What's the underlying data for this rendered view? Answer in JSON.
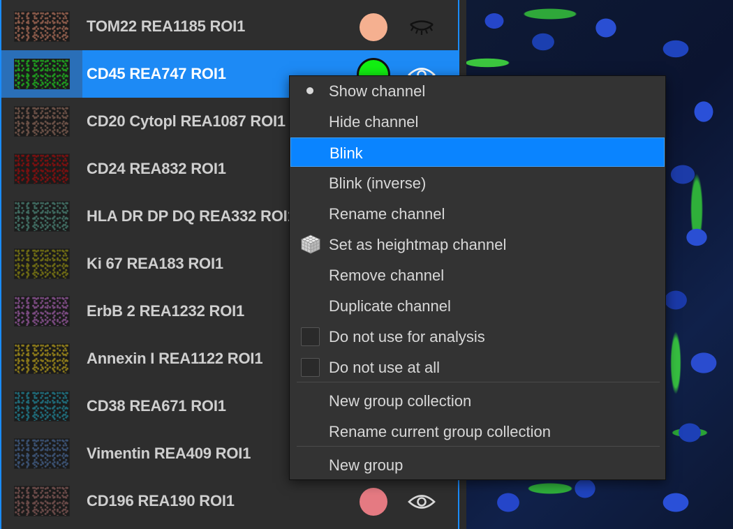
{
  "channels": [
    {
      "label": "TOM22 REA1185 ROI1",
      "swatch": "#f5b090",
      "visibility": "eye-closed-icon",
      "thumb_tint": "#8a5a4a"
    },
    {
      "label": "CD45 REA747 ROI1",
      "swatch": "#12f012",
      "visibility": "eye-open-icon",
      "thumb_tint": "#1f9a1f",
      "selected": true
    },
    {
      "label": "CD20 Cytopl REA1087 ROI1",
      "thumb_tint": "#6a5046"
    },
    {
      "label": "CD24 REA832 ROI1",
      "thumb_tint": "#7a1010"
    },
    {
      "label": "HLA DR DP DQ REA332 ROI1",
      "thumb_tint": "#3f6a60"
    },
    {
      "label": "Ki 67 REA183 ROI1",
      "thumb_tint": "#6d6a14"
    },
    {
      "label": "ErbB 2 REA1232 ROI1",
      "thumb_tint": "#7a4a80"
    },
    {
      "label": "Annexin I REA1122 ROI1",
      "thumb_tint": "#8c7a1a"
    },
    {
      "label": "CD38 REA671 ROI1",
      "thumb_tint": "#1f6a78"
    },
    {
      "label": "Vimentin REA409 ROI1",
      "thumb_tint": "#3a5070"
    },
    {
      "label": "CD196 REA190 ROI1",
      "swatch": "#e57a82",
      "visibility": "eye-open-icon",
      "thumb_tint": "#6a4a48"
    }
  ],
  "menu": {
    "items": [
      {
        "label": "Show channel",
        "marker": "bullet"
      },
      {
        "label": "Hide channel"
      },
      {
        "label": "Blink",
        "highlighted": true
      },
      {
        "label": "Blink (inverse)"
      },
      {
        "label": "Rename channel"
      },
      {
        "label": "Set as heightmap channel",
        "marker": "cube-icon"
      },
      {
        "label": "Remove channel"
      },
      {
        "label": "Duplicate channel"
      },
      {
        "label": "Do not use for analysis",
        "marker": "checkbox",
        "checked": false
      },
      {
        "label": "Do not use at all",
        "marker": "checkbox",
        "checked": false
      },
      {
        "label": "New group collection"
      },
      {
        "label": "Rename current group collection"
      },
      {
        "label": "New group"
      }
    ]
  },
  "colors": {
    "accent": "#0a84ff",
    "panel_bg": "#2e2e2e",
    "menu_bg": "#333333"
  }
}
